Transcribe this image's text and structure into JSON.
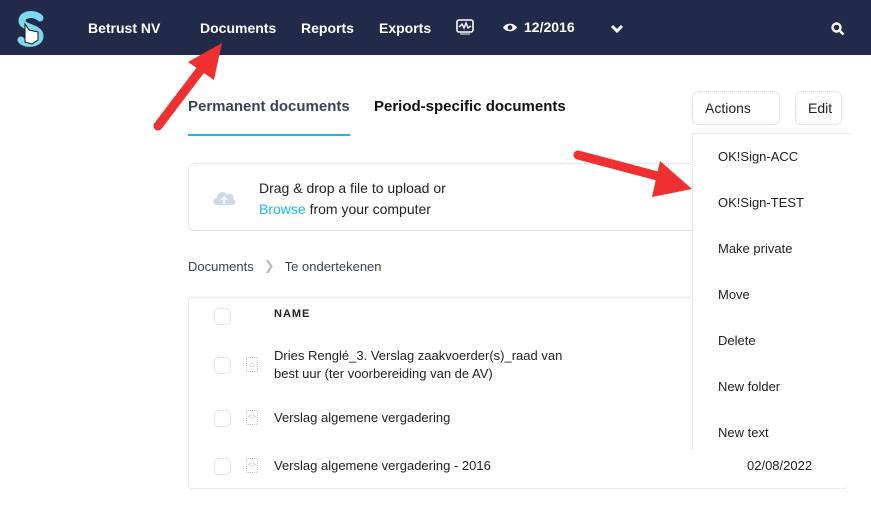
{
  "topbar": {
    "company": "Betrust NV",
    "nav": [
      "Documents",
      "Reports",
      "Exports"
    ],
    "period": "12/2016",
    "colors": {
      "bar": "#222a4a",
      "accent": "#1ab7ea"
    }
  },
  "tabs": [
    {
      "label": "Permanent documents",
      "active": true
    },
    {
      "label": "Period-specific documents",
      "active": false
    }
  ],
  "toolbar": {
    "actions_label": "Actions",
    "edit_label": "Edit"
  },
  "upload": {
    "line1": "Drag & drop a file to upload or",
    "browse": "Browse",
    "line2_rest": " from your computer"
  },
  "breadcrumb": [
    "Documents",
    "Te ondertekenen"
  ],
  "table": {
    "header": {
      "name": "NAME"
    },
    "rows": [
      {
        "name": "Dries Renglé_3. Verslag zaakvoerder(s)_raad van best uur (ter voorbereiding van de AV)",
        "icon": "pdf-file-icon",
        "date": ""
      },
      {
        "name": "Verslag algemene vergadering",
        "icon": "code-file-icon",
        "date": ""
      },
      {
        "name": "Verslag algemene vergadering - 2016",
        "icon": "code-file-icon",
        "date": "02/08/2022"
      }
    ]
  },
  "actions_menu": {
    "items": [
      "OK!Sign-ACC",
      "OK!Sign-TEST",
      "Make private",
      "Move",
      "Delete",
      "New folder",
      "New text"
    ]
  },
  "annotations": {
    "arrow_color": "#f03030"
  }
}
